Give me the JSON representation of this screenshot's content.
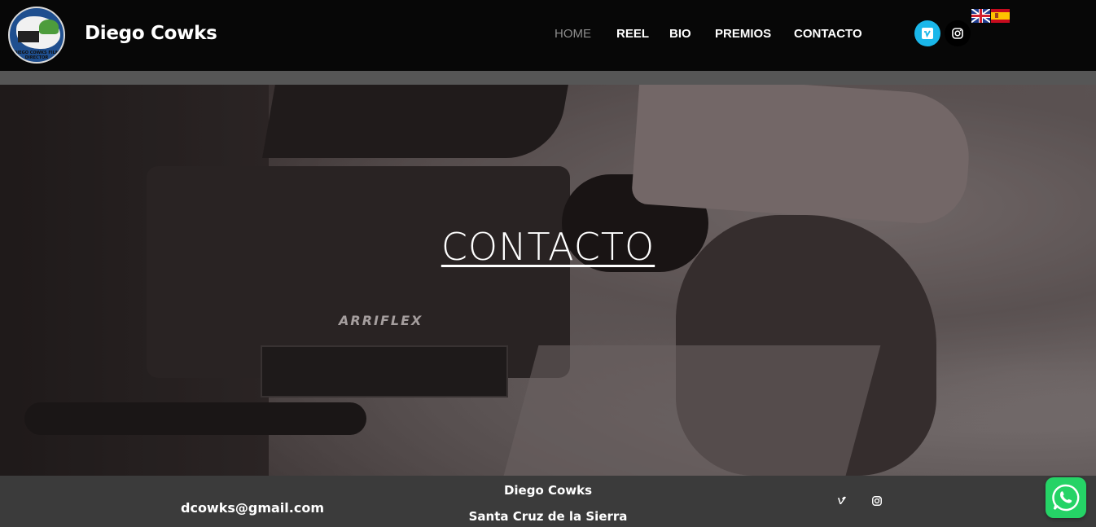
{
  "header": {
    "logo_text": "DIEGO COWKS FILM DIRECTOR",
    "brand": "Diego Cowks",
    "nav": [
      {
        "label": "HOME",
        "active": true
      },
      {
        "label": "REEL",
        "active": false
      },
      {
        "label": "BIO",
        "active": false
      },
      {
        "label": "PREMIOS",
        "active": false
      },
      {
        "label": "CONTACTO",
        "active": false
      }
    ],
    "social": [
      {
        "icon": "vimeo-icon",
        "color": "#1ab7ea"
      },
      {
        "icon": "instagram-icon",
        "color": "#000000"
      }
    ],
    "languages": [
      {
        "icon": "uk-flag-icon"
      },
      {
        "icon": "spain-flag-icon"
      }
    ]
  },
  "hero": {
    "title": "CONTACTO",
    "background": "grayscale photo of a camera operator with an Arriflex camera",
    "camera_brand": "ARRIFLEX"
  },
  "footer": {
    "email": "dcowks@gmail.com",
    "name": "Diego Cowks",
    "city": "Santa Cruz de la Sierra",
    "social": [
      {
        "icon": "vimeo-icon"
      },
      {
        "icon": "instagram-icon"
      }
    ]
  },
  "floating": {
    "icon": "whatsapp-icon",
    "color": "#25d366"
  }
}
